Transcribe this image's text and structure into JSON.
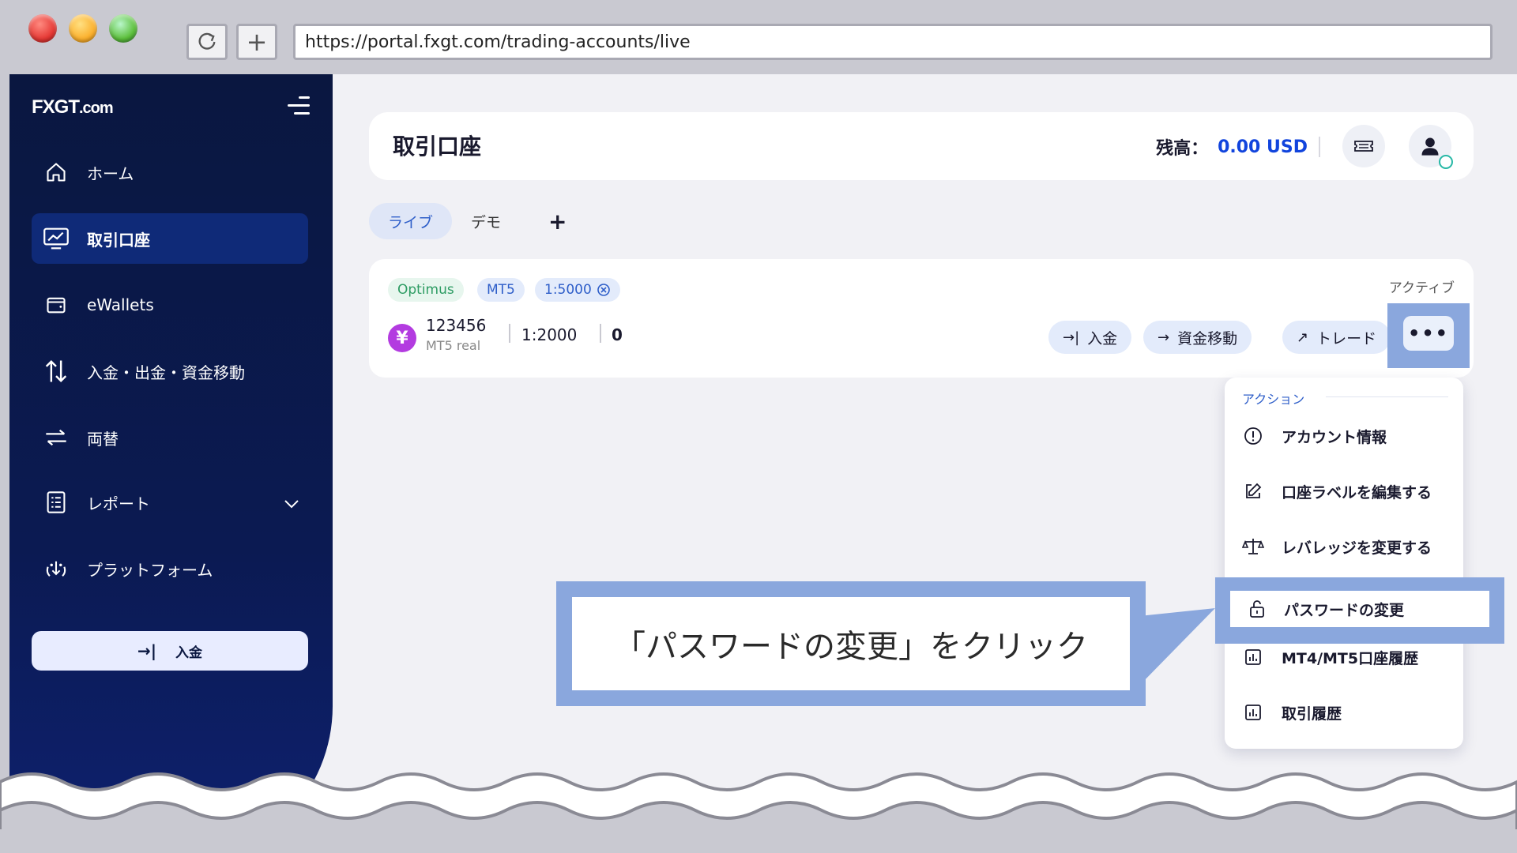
{
  "browser": {
    "url": "https://portal.fxgt.com/trading-accounts/live"
  },
  "sidebar": {
    "logo_main": "FXGT",
    "logo_suffix": ".com",
    "items": [
      {
        "label": "ホーム",
        "icon": "home-icon"
      },
      {
        "label": "取引口座",
        "icon": "chart-monitor-icon",
        "active": true
      },
      {
        "label": "eWallets",
        "icon": "wallet-icon"
      },
      {
        "label": "入金・出金・資金移動",
        "icon": "transfer-arrows-icon"
      },
      {
        "label": "両替",
        "icon": "exchange-icon"
      },
      {
        "label": "レポート",
        "icon": "report-icon"
      },
      {
        "label": "プラットフォーム",
        "icon": "platform-icon"
      }
    ],
    "deposit_label": "入金"
  },
  "header": {
    "title": "取引口座",
    "balance_label": "残高：",
    "balance_amount": "0.00 USD"
  },
  "tabs": [
    {
      "label": "ライブ",
      "active": true
    },
    {
      "label": "デモ",
      "active": false
    }
  ],
  "account": {
    "badges": [
      "Optimus",
      "MT5",
      "1:5000"
    ],
    "status": "アクティブ",
    "number": "123456",
    "type": "MT5 real",
    "leverage": "1:2000",
    "balance": "0",
    "actions": [
      "入金",
      "資金移動",
      "トレード"
    ],
    "more_label": "•••"
  },
  "dropdown": {
    "heading": "アクション",
    "items": [
      "アカウント情報",
      "口座ラベルを編集する",
      "レバレッジを変更する",
      "パスワードの変更",
      "MT4/MT5口座履歴",
      "取引履歴"
    ]
  },
  "callout": {
    "text": "「パスワードの変更」をクリック"
  },
  "colors": {
    "sidebar_bg": "#0a1740",
    "accent_blue": "#1144dd",
    "highlight": "#8aa7dd"
  }
}
